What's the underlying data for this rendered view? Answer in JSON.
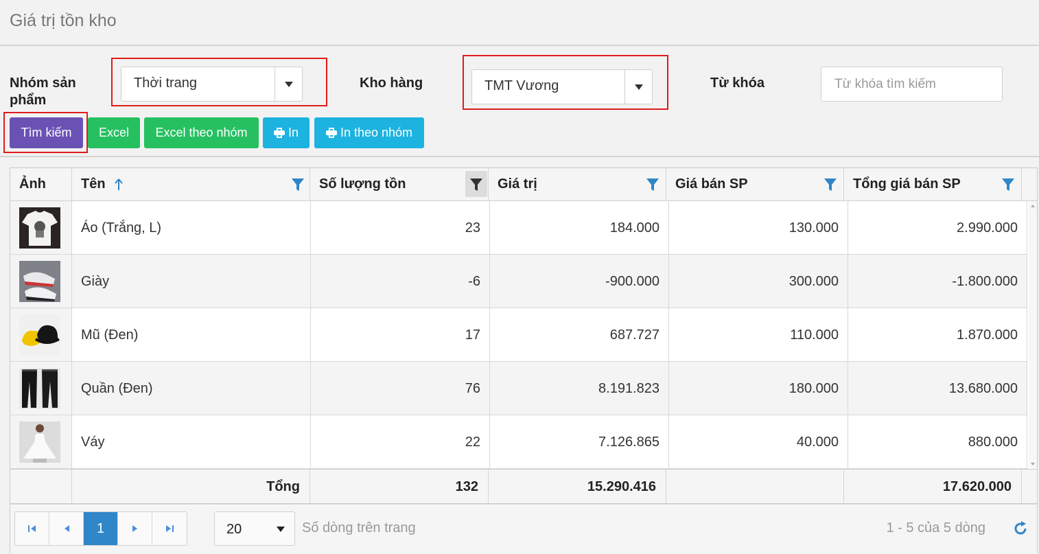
{
  "page": {
    "title": "Giá trị tồn kho"
  },
  "filters": {
    "group_label": "Nhóm sản phẩm",
    "group_value": "Thời trang",
    "warehouse_label": "Kho hàng",
    "warehouse_value": "TMT Vương",
    "keyword_label": "Từ khóa",
    "keyword_placeholder": "Từ khóa tìm kiếm",
    "keyword_value": ""
  },
  "toolbar": {
    "search": "Tìm kiếm",
    "excel": "Excel",
    "excel_group": "Excel theo nhóm",
    "print": "In",
    "print_group": "In theo nhóm"
  },
  "table": {
    "columns": [
      "Ảnh",
      "Tên",
      "Số lượng tồn",
      "Giá trị",
      "Giá bán SP",
      "Tổng giá bán SP"
    ],
    "rows": [
      {
        "image": "white-tshirt-photo",
        "name": "Áo (Trắng, L)",
        "qty": "23",
        "value": "184.000",
        "price": "130.000",
        "total": "2.990.000"
      },
      {
        "image": "sneaker-photo",
        "name": "Giày",
        "qty": "-6",
        "value": "-900.000",
        "price": "300.000",
        "total": "-1.800.000"
      },
      {
        "image": "bucket-hat-photo",
        "name": "Mũ (Đen)",
        "qty": "17",
        "value": "687.727",
        "price": "110.000",
        "total": "1.870.000"
      },
      {
        "image": "black-pants-photo",
        "name": "Quần (Đen)",
        "qty": "76",
        "value": "8.191.823",
        "price": "180.000",
        "total": "13.680.000"
      },
      {
        "image": "white-dress-photo",
        "name": "Váy",
        "qty": "22",
        "value": "7.126.865",
        "price": "40.000",
        "total": "880.000"
      }
    ],
    "footer": {
      "label": "Tổng",
      "qty": "132",
      "value": "15.290.416",
      "price": "",
      "total": "17.620.000"
    }
  },
  "pager": {
    "current_page": "1",
    "page_size": "20",
    "page_size_label": "Số dòng trên trang",
    "info": "1 - 5 của 5 dòng"
  },
  "colors": {
    "search_button": "#6a52b5",
    "excel_button": "#26c061",
    "print_button": "#1cb3e0",
    "highlight_box": "#e01b1b",
    "filter_icon": "#2f86c9",
    "current_page": "#2f86c9"
  }
}
